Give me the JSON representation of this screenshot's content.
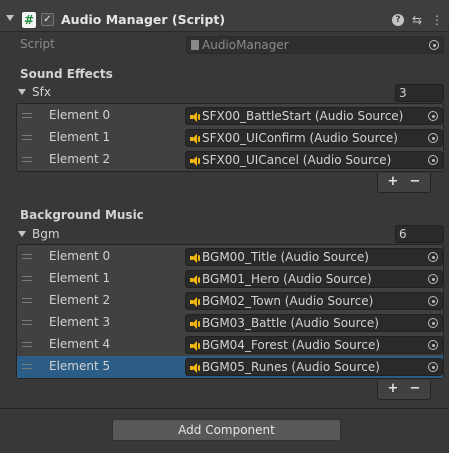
{
  "component": {
    "title": "Audio Manager (Script)",
    "icon": "csharp-script-icon",
    "enabled": true,
    "header_icons": [
      "help-icon",
      "presets-icon",
      "kebab-menu-icon"
    ]
  },
  "script": {
    "label": "Script",
    "value": "AudioManager"
  },
  "sound_effects": {
    "header": "Sound Effects",
    "array_name": "Sfx",
    "size": "3",
    "elements": [
      {
        "label": "Element 0",
        "value": "SFX00_BattleStart (Audio Source)"
      },
      {
        "label": "Element 1",
        "value": "SFX00_UIConfirm (Audio Source)"
      },
      {
        "label": "Element 2",
        "value": "SFX00_UICancel (Audio Source)"
      }
    ]
  },
  "background_music": {
    "header": "Background Music",
    "array_name": "Bgm",
    "size": "6",
    "selected_index": 5,
    "elements": [
      {
        "label": "Element 0",
        "value": "BGM00_Title (Audio Source)"
      },
      {
        "label": "Element 1",
        "value": "BGM01_Hero (Audio Source)"
      },
      {
        "label": "Element 2",
        "value": "BGM02_Town (Audio Source)"
      },
      {
        "label": "Element 3",
        "value": "BGM03_Battle (Audio Source)"
      },
      {
        "label": "Element 4",
        "value": "BGM04_Forest (Audio Source)"
      },
      {
        "label": "Element 5",
        "value": "BGM05_Runes (Audio Source)"
      }
    ]
  },
  "list_controls": {
    "add": "+",
    "remove": "−"
  },
  "add_component_label": "Add Component",
  "colors": {
    "selection": "#2c5d87",
    "audio_icon": "#f2b60e",
    "background": "#383838"
  }
}
